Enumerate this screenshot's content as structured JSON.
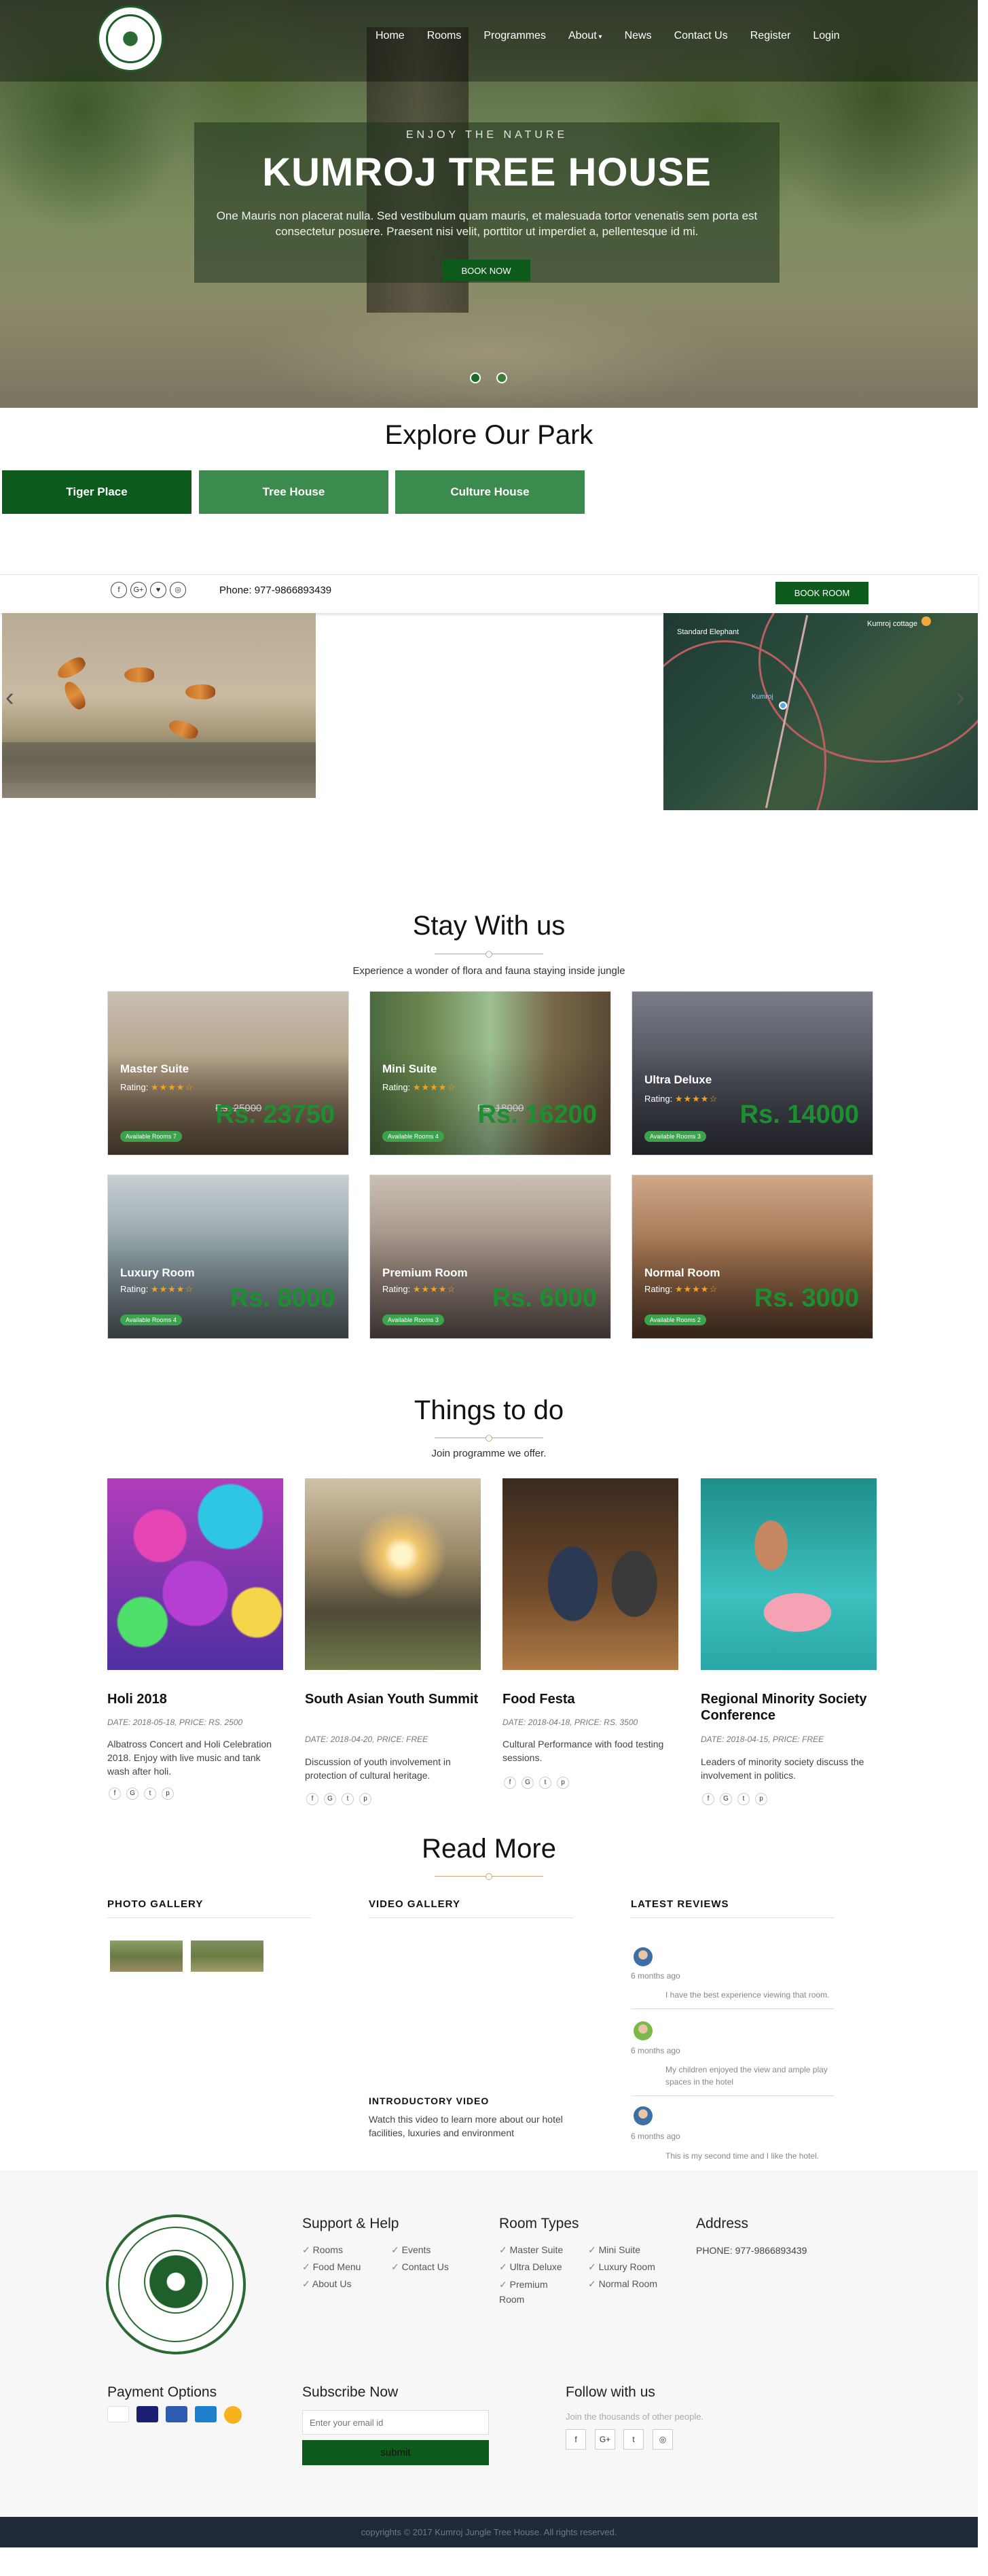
{
  "nav": {
    "home": "Home",
    "rooms": "Rooms",
    "programmes": "Programmes",
    "about": "About",
    "news": "News",
    "contact": "Contact Us",
    "register": "Register",
    "login": "Login"
  },
  "hero": {
    "eyebrow": "ENJOY THE NATURE",
    "title": "KUMROJ TREE HOUSE",
    "desc": "One Mauris non placerat nulla. Sed vestibulum quam mauris, et malesuada tortor venenatis sem porta est consectetur posuere. Praesent nisi velit, porttitor ut imperdiet a, pellentesque id mi.",
    "button": "BOOK NOW",
    "active_slide": 1,
    "slide_count": 2
  },
  "explore": {
    "title": "Explore Our Park",
    "tabs": [
      "Tiger Place",
      "Tree House",
      "Culture House"
    ]
  },
  "infobar": {
    "social": [
      "f",
      "G+",
      "♥",
      "◎"
    ],
    "phone": "Phone: 977-9866893439",
    "button": "BOOK ROOM"
  },
  "map": {
    "label1": "Standard Elephant",
    "label2": "Kumroj cottage",
    "label3": "Kumroj"
  },
  "stay": {
    "title": "Stay With us",
    "subtitle": "Experience a wonder of flora and fauna staying inside jungle",
    "rating_label": "Rating:",
    "rooms": [
      {
        "name": "Master Suite",
        "stars": 4,
        "old": "Rs. 25000",
        "price": "Rs. 23750",
        "avail": "Available Rooms 7"
      },
      {
        "name": "Mini Suite",
        "stars": 4,
        "old": "Rs. 18000",
        "price": "Rs. 16200",
        "avail": "Available Rooms 4"
      },
      {
        "name": "Ultra Deluxe",
        "stars": 4,
        "old": "",
        "price": "Rs. 14000",
        "avail": "Available Rooms 3"
      },
      {
        "name": "Luxury Room",
        "stars": 4,
        "old": "",
        "price": "Rs. 8000",
        "avail": "Available Rooms 4"
      },
      {
        "name": "Premium Room",
        "stars": 4,
        "old": "",
        "price": "Rs. 6000",
        "avail": "Available Rooms 3"
      },
      {
        "name": "Normal Room",
        "stars": 4,
        "old": "",
        "price": "Rs. 3000",
        "avail": "Available Rooms 2"
      }
    ]
  },
  "things": {
    "title": "Things to do",
    "subtitle": "Join programme we offer.",
    "items": [
      {
        "title": "Holi 2018",
        "date": "DATE: 2018-05-18, PRICE: RS. 2500",
        "desc": "Albatross Concert and Holi Celebration 2018. Enjoy with live music and tank wash after holi."
      },
      {
        "title": "South Asian Youth Summit",
        "date": "DATE: 2018-04-20, PRICE: FREE",
        "desc": "Discussion of youth involvement in protection of cultural heritage."
      },
      {
        "title": "Food Festa",
        "date": "DATE: 2018-04-18, PRICE: RS. 3500",
        "desc": "Cultural Performance with food testing sessions."
      },
      {
        "title": "Regional Minority Society Conference",
        "date": "DATE: 2018-04-15, PRICE: FREE",
        "desc": "Leaders of minority society discuss the involvement in politics."
      }
    ]
  },
  "readmore": {
    "title": "Read More",
    "photo": "PHOTO GALLERY",
    "video": "VIDEO GALLERY",
    "reviews": "LATEST REVIEWS",
    "intro_title": "INTRODUCTORY VIDEO",
    "intro_desc": "Watch this video to learn more about our hotel facilities, luxuries and environment",
    "review_items": [
      {
        "time": "6 months ago",
        "text": "I have the best experience viewing that room."
      },
      {
        "time": "6 months ago",
        "text": "My children enjoyed the view and ample play spaces in the hotel"
      },
      {
        "time": "6 months ago",
        "text": "This is my second time and I like the hotel."
      }
    ]
  },
  "footer": {
    "support": "Support & Help",
    "support_items": [
      "Rooms",
      "Events",
      "Food Menu",
      "Contact Us",
      "About Us"
    ],
    "roomtypes": "Room Types",
    "room_items": [
      "Master Suite",
      "Mini Suite",
      "Ultra Deluxe",
      "Luxury Room",
      "Premium Room",
      "Normal Room"
    ],
    "address": "Address",
    "phone": "PHONE: 977-9866893439",
    "payment": "Payment Options",
    "subscribe": "Subscribe Now",
    "email_placeholder": "Enter your email id",
    "submit": "submit",
    "follow": "Follow with us",
    "follow_sub": "Join the thousands of other people.",
    "copyright": "copyrights © 2017 Kumroj Jungle Tree House.   All rights reserved."
  },
  "colors": {
    "primary": "#0c5b1c",
    "accent": "#3b8a4e",
    "price": "#1c8f31",
    "star": "#f3a21c"
  }
}
